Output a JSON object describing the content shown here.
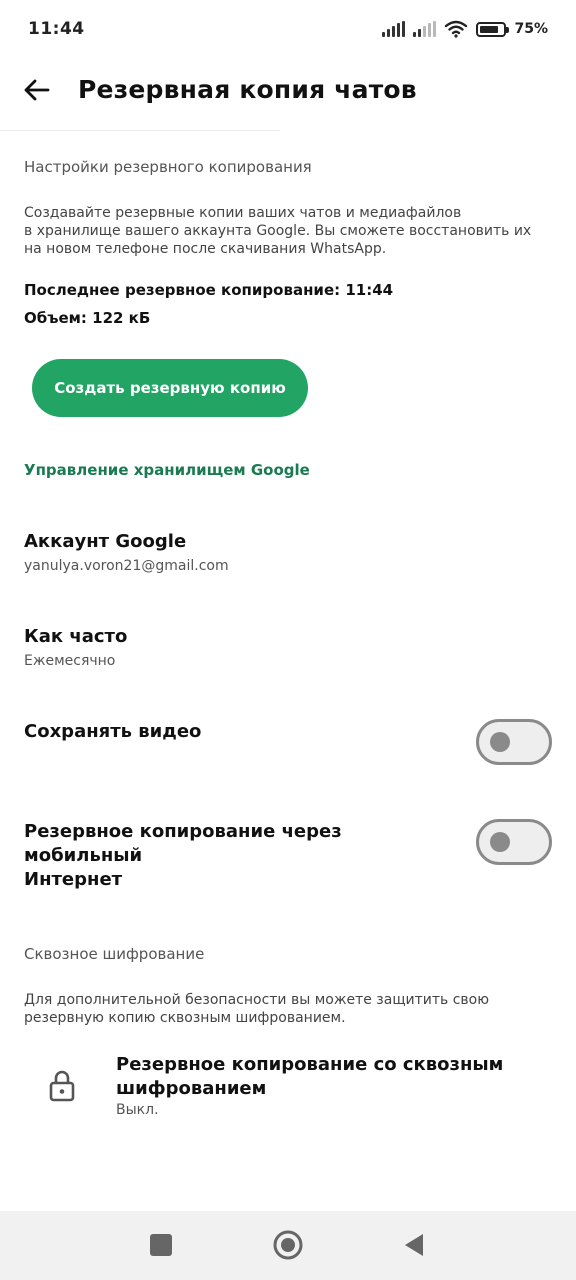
{
  "status_bar": {
    "time": "11:44",
    "battery_percent": "75%",
    "battery_level": 0.75
  },
  "app_bar": {
    "title": "Резервная копия чатов",
    "back_icon": "arrow-left-icon"
  },
  "backup_settings": {
    "header": "Настройки резервного копирования",
    "description_lines": [
      "Создавайте резервные копии ваших чатов и медиафайлов",
      "в хранилище вашего аккаунта Google. Вы сможете восстановить их",
      "на новом телефоне после скачивания WhatsApp."
    ],
    "last_backup": "Последнее резервное копирование: 11:44",
    "size": "Объем: 122 кБ",
    "backup_button": "Создать резервную копию",
    "manage_storage_link": "Управление хранилищем Google"
  },
  "settings": {
    "google_account": {
      "title": "Аккаунт Google",
      "value": "yanulya.voron21@gmail.com"
    },
    "frequency": {
      "title": "Как часто",
      "value": "Ежемесячно"
    },
    "include_video": {
      "title": "Сохранять видео",
      "enabled": false
    },
    "cellular_backup": {
      "title_line1": "Резервное копирование через мобильный",
      "title_line2": "Интернет",
      "enabled": false
    }
  },
  "encryption": {
    "header": "Сквозное шифрование",
    "description_lines": [
      "Для дополнительной безопасности вы можете защитить свою",
      "резервную копию сквозным шифрованием."
    ],
    "item_title_line1": "Резервное копирование со сквозным",
    "item_title_line2": "шифрованием",
    "item_status": "Выкл.",
    "icon": "lock-icon"
  },
  "colors": {
    "accent_green": "#21a464",
    "link_green": "#1b7a52",
    "toggle_off": "#8a8a8a"
  }
}
